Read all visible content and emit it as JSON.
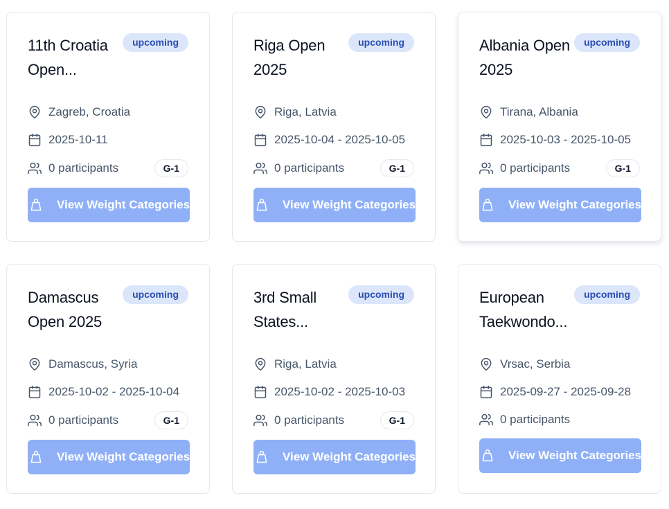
{
  "cards": [
    {
      "title": "11th Croatia Open...",
      "status": "upcoming",
      "location": "Zagreb, Croatia",
      "dates": "2025-10-11",
      "participants": "0 participants",
      "grade": "G-1",
      "button_label": "View Weight Categories"
    },
    {
      "title": "Riga Open 2025",
      "status": "upcoming",
      "location": "Riga, Latvia",
      "dates": "2025-10-04 - 2025-10-05",
      "participants": "0 participants",
      "grade": "G-1",
      "button_label": "View Weight Categories"
    },
    {
      "title": "Albania Open 2025",
      "status": "upcoming",
      "location": "Tirana, Albania",
      "dates": "2025-10-03 - 2025-10-05",
      "participants": "0 participants",
      "grade": "G-1",
      "button_label": "View Weight Categories"
    },
    {
      "title": "Damascus Open 2025",
      "status": "upcoming",
      "location": "Damascus, Syria",
      "dates": "2025-10-02 - 2025-10-04",
      "participants": "0 participants",
      "grade": "G-1",
      "button_label": "View Weight Categories"
    },
    {
      "title": "3rd Small States...",
      "status": "upcoming",
      "location": "Riga, Latvia",
      "dates": "2025-10-02 - 2025-10-03",
      "participants": "0 participants",
      "grade": "G-1",
      "button_label": "View Weight Categories"
    },
    {
      "title": "European Taekwondo...",
      "status": "upcoming",
      "location": "Vrsac, Serbia",
      "dates": "2025-09-27 - 2025-09-28",
      "participants": "0 participants",
      "grade": "",
      "button_label": "View Weight Categories"
    }
  ],
  "icons": {
    "location": "map-pin-icon",
    "date": "calendar-icon",
    "participants": "users-icon",
    "button": "weight-icon"
  },
  "colors": {
    "badge_bg": "#dbe6fb",
    "badge_text": "#2a4db0",
    "button_bg": "#8fb0f7"
  }
}
